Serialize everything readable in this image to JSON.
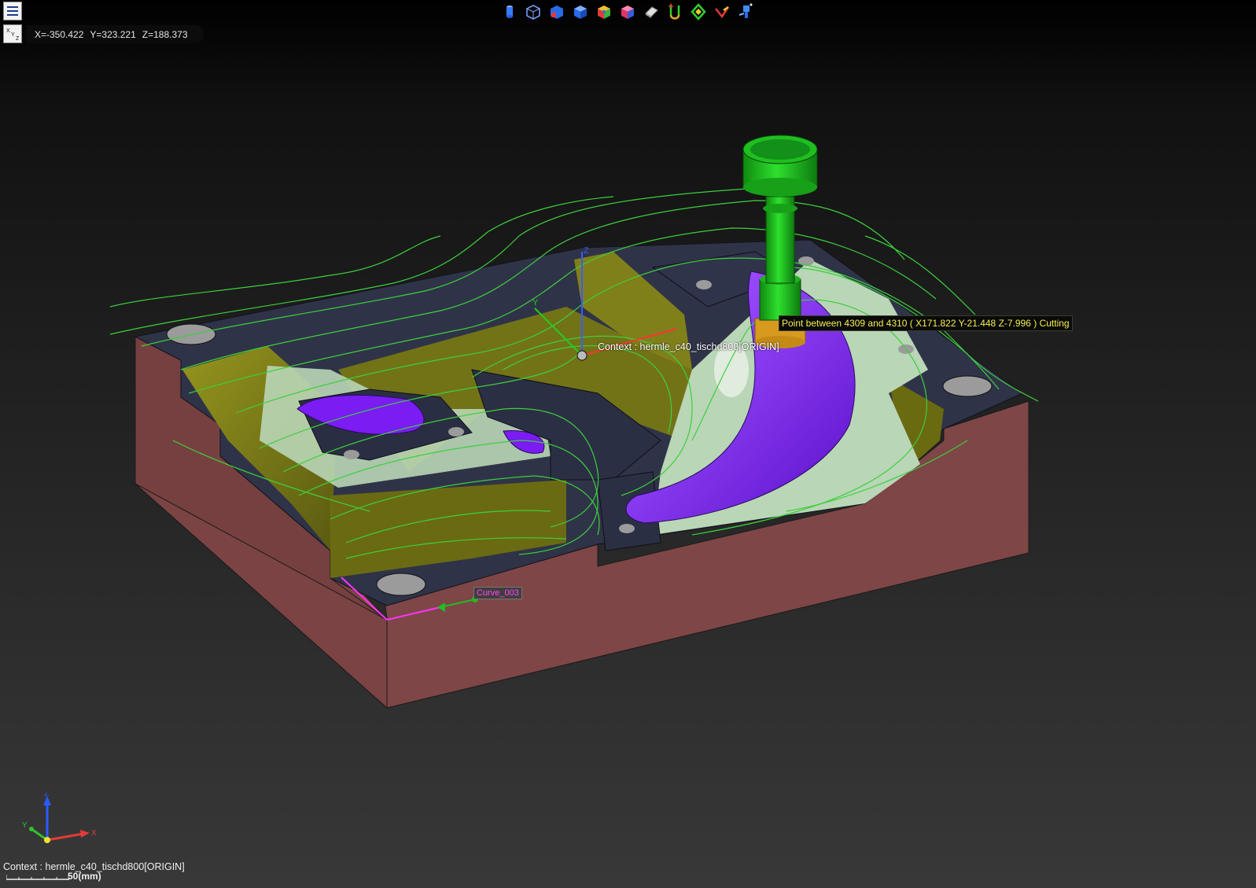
{
  "coords": {
    "x": "X=-350.422",
    "y": "Y=323.221",
    "z": "Z=188.373"
  },
  "axes_button_glyph": "XYZ",
  "toolbar": [
    {
      "icon": "cylinder-icon"
    },
    {
      "icon": "wire-box-icon"
    },
    {
      "icon": "box-cut-icon"
    },
    {
      "icon": "solid-box-icon"
    },
    {
      "icon": "color-box-icon"
    },
    {
      "icon": "stock-box-icon"
    },
    {
      "icon": "eraser-icon"
    },
    {
      "icon": "path-down-icon"
    },
    {
      "icon": "path-diamond-icon"
    },
    {
      "icon": "path-reverse-icon"
    },
    {
      "icon": "tool-holder-icon"
    }
  ],
  "viewport": {
    "tooltip_point": "Point between 4309 and 4310 ( X171.822 Y-21.448 Z-7.996 ) Cutting",
    "origin_context": "Context : hermle_c40_tischd800[ORIGIN]",
    "origin_axis_y": "Y",
    "origin_axis_z": "Z",
    "curve_label": "Curve_003"
  },
  "triad": {
    "x": "X",
    "y": "Y",
    "z": "Z"
  },
  "status": {
    "context": "Context : hermle_c40_tischd800[ORIGIN]",
    "scale_label": "50(mm)"
  },
  "colors": {
    "stock_side": "#7b4343",
    "floor_dark": "#2f3348",
    "wall_olive": "#7a7a12",
    "light_green_face": "#b9d6b6",
    "purple_face": "#7a1cf2",
    "toolpath_green": "#3dcf3d",
    "tool_green": "#22cc22",
    "tool_tip_orange": "#d59a1e",
    "tooltip_text": "#f6f051"
  }
}
